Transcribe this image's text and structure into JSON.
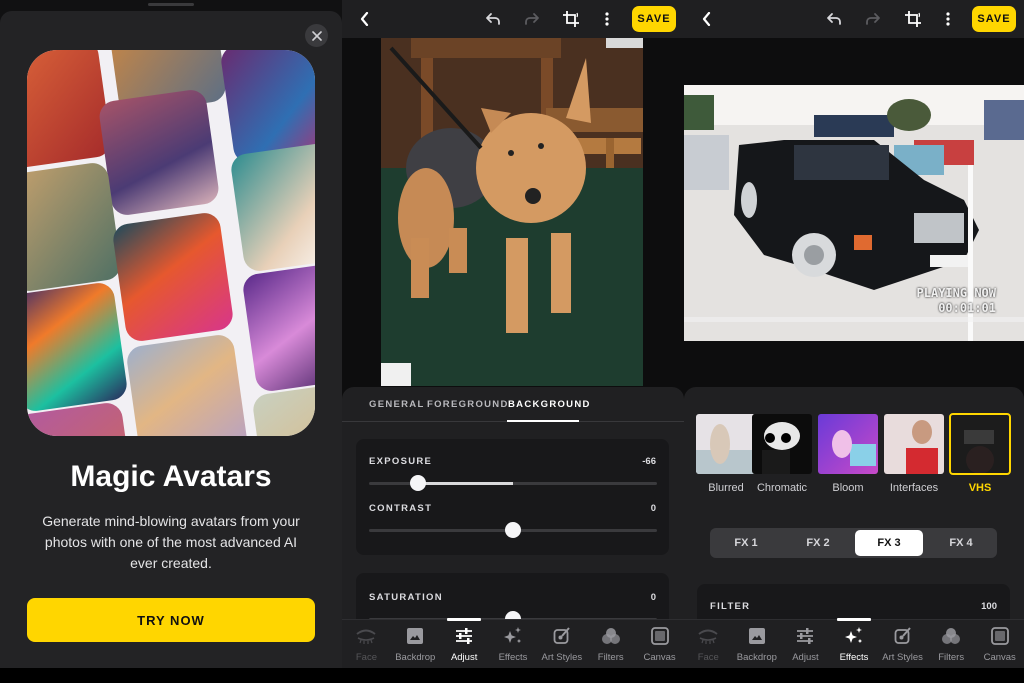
{
  "promo": {
    "title": "Magic Avatars",
    "description": "Generate mind-blowing avatars from your photos with one of the most advanced AI ever created.",
    "cta_label": "TRY NOW",
    "close_icon": "close-icon",
    "hero_image": "avatar-collage"
  },
  "editor_adjust": {
    "toolbar": {
      "back_icon": "chevron-left-icon",
      "undo_icon": "undo-icon",
      "redo_icon": "redo-icon",
      "crop_icon": "crop-rotate-icon",
      "more_icon": "more-vertical-icon",
      "save_label": "SAVE"
    },
    "photo": "dog-photo",
    "tabs": [
      {
        "label": "GENERAL",
        "active": false
      },
      {
        "label": "FOREGROUND",
        "active": false
      },
      {
        "label": "BACKGROUND",
        "active": true
      }
    ],
    "sliders": [
      {
        "label": "EXPOSURE",
        "value": "-66",
        "numeric": -66,
        "min": -100,
        "max": 100
      },
      {
        "label": "CONTRAST",
        "value": "0",
        "numeric": 0,
        "min": -100,
        "max": 100
      },
      {
        "label": "SATURATION",
        "value": "0",
        "numeric": 0,
        "min": -100,
        "max": 100
      }
    ],
    "nav": [
      {
        "label": "Face",
        "icon": "face-eye-icon",
        "state": "disabled"
      },
      {
        "label": "Backdrop",
        "icon": "image-icon",
        "state": "normal"
      },
      {
        "label": "Adjust",
        "icon": "sliders-icon",
        "state": "active"
      },
      {
        "label": "Effects",
        "icon": "sparkles-icon",
        "state": "normal"
      },
      {
        "label": "Art Styles",
        "icon": "paintbrush-icon",
        "state": "normal"
      },
      {
        "label": "Filters",
        "icon": "circles-icon",
        "state": "normal"
      },
      {
        "label": "Canvas",
        "icon": "canvas-square-icon",
        "state": "normal"
      }
    ]
  },
  "editor_effects": {
    "toolbar": {
      "back_icon": "chevron-left-icon",
      "undo_icon": "undo-icon",
      "redo_icon": "redo-icon",
      "crop_icon": "crop-rotate-icon",
      "more_icon": "more-vertical-icon",
      "save_label": "SAVE"
    },
    "photo": "car-vhs-photo",
    "overlay_text": {
      "line1": "PLAYING NOW",
      "line2": "00:01:01"
    },
    "effects": [
      {
        "label": "Blurred",
        "selected": false
      },
      {
        "label": "Chromatic",
        "selected": false
      },
      {
        "label": "Bloom",
        "selected": false
      },
      {
        "label": "Interfaces",
        "selected": false
      },
      {
        "label": "VHS",
        "selected": true
      }
    ],
    "variants": [
      {
        "label": "FX 1",
        "active": false
      },
      {
        "label": "FX 2",
        "active": false
      },
      {
        "label": "FX 3",
        "active": true
      },
      {
        "label": "FX 4",
        "active": false
      }
    ],
    "filter": {
      "label": "FILTER",
      "value": "100",
      "numeric": 100
    },
    "nav": [
      {
        "label": "Face",
        "icon": "face-eye-icon",
        "state": "disabled"
      },
      {
        "label": "Backdrop",
        "icon": "image-icon",
        "state": "normal"
      },
      {
        "label": "Adjust",
        "icon": "sliders-icon",
        "state": "normal"
      },
      {
        "label": "Effects",
        "icon": "sparkles-icon",
        "state": "active"
      },
      {
        "label": "Art Styles",
        "icon": "paintbrush-icon",
        "state": "normal"
      },
      {
        "label": "Filters",
        "icon": "circles-icon",
        "state": "normal"
      },
      {
        "label": "Canvas",
        "icon": "canvas-square-icon",
        "state": "normal"
      }
    ]
  },
  "colors": {
    "accent_yellow": "#ffd600",
    "panel_bg": "#202022",
    "card_bg": "#18181a"
  }
}
